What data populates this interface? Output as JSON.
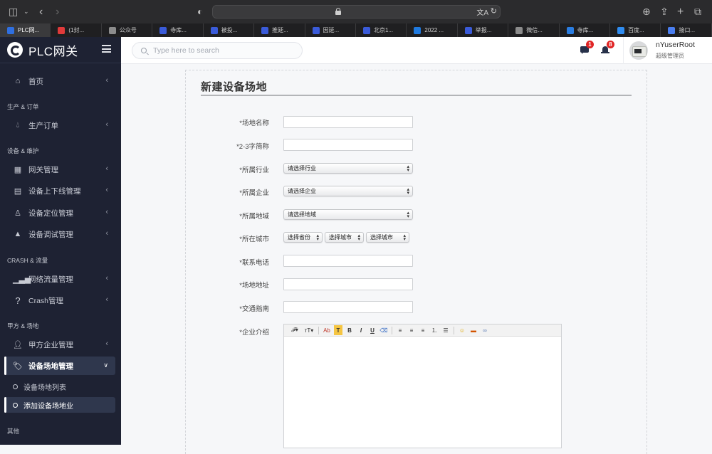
{
  "browser": {
    "tabs": [
      {
        "label": "PLC网...",
        "favicon_color": "#2f6fe0",
        "active": true
      },
      {
        "label": "(1封...",
        "favicon_color": "#e03a3a",
        "active": false
      },
      {
        "label": "公众号",
        "favicon_color": "#8c8c8c",
        "active": false
      },
      {
        "label": "寺库...",
        "favicon_color": "#3a5bd9",
        "active": false
      },
      {
        "label": "被投...",
        "favicon_color": "#3a5bd9",
        "active": false
      },
      {
        "label": "推延...",
        "favicon_color": "#3a5bd9",
        "active": false
      },
      {
        "label": "因延...",
        "favicon_color": "#3a5bd9",
        "active": false
      },
      {
        "label": "北京1...",
        "favicon_color": "#3a5bd9",
        "active": false
      },
      {
        "label": "2022 ...",
        "favicon_color": "#1f7ae0",
        "active": false
      },
      {
        "label": "举报...",
        "favicon_color": "#3a5bd9",
        "active": false
      },
      {
        "label": "微信...",
        "favicon_color": "#8c8c8c",
        "active": false
      },
      {
        "label": "寺库...",
        "favicon_color": "#2a7de1",
        "active": false
      },
      {
        "label": "百度...",
        "favicon_color": "#2f8cf0",
        "active": false
      },
      {
        "label": "接口...",
        "favicon_color": "#4a7ef0",
        "active": false
      }
    ]
  },
  "sidebar": {
    "brand": "PLC网关",
    "sections": [
      {
        "title": ""
      },
      {
        "title": "生产 & 订单"
      },
      {
        "title": "设备 & 维护"
      },
      {
        "title": "CRASH & 流量"
      },
      {
        "title": "甲方 & 场地"
      },
      {
        "title": "其他"
      }
    ],
    "items": [
      {
        "label": "首页",
        "icon": "home-icon"
      },
      {
        "label": "生产订单",
        "icon": "drop-icon"
      },
      {
        "label": "网关管理",
        "icon": "grid-icon"
      },
      {
        "label": "设备上下线管理",
        "icon": "document-icon"
      },
      {
        "label": "设备定位管理",
        "icon": "map-pin-user-icon"
      },
      {
        "label": "设备调试管理",
        "icon": "warning-icon"
      },
      {
        "label": "网络流量管理",
        "icon": "bar-chart-icon"
      },
      {
        "label": "Crash管理",
        "icon": "question-icon"
      },
      {
        "label": "甲方企业管理",
        "icon": "users-icon"
      },
      {
        "label": "设备场地管理",
        "icon": "tag-icon"
      }
    ],
    "subitems": [
      {
        "label": "设备场地列表"
      },
      {
        "label": "添加设备场地业"
      }
    ]
  },
  "header": {
    "search_placeholder": "Type here to search",
    "messages_count": "1",
    "notifications_count": "8",
    "user_name": "nYuserRoot",
    "user_role": "超级管理员"
  },
  "form": {
    "title": "新建设备场地",
    "fields": {
      "site_name": {
        "label": "*场地名称",
        "value": ""
      },
      "short_name": {
        "label": "*2-3字简称",
        "value": ""
      },
      "industry": {
        "label": "*所属行业",
        "selected": "请选择行业"
      },
      "company": {
        "label": "*所属企业",
        "selected": "请选择企业"
      },
      "region": {
        "label": "*所属地域",
        "selected": "请选择地域"
      },
      "city": {
        "label": "*所在城市",
        "province_selected": "选择省份",
        "city_selected": "选择城市",
        "district_selected": "选择城市"
      },
      "phone": {
        "label": "*联系电话",
        "value": ""
      },
      "address": {
        "label": "*场地地址",
        "value": ""
      },
      "traffic": {
        "label": "*交通指南",
        "value": ""
      },
      "intro": {
        "label": "*企业介绍",
        "value": ""
      }
    },
    "editor_toolbar": {
      "font_family": "𝓕▾",
      "font_size": "тT▾",
      "font_color": "Ab",
      "highlight": "T",
      "bold": "B",
      "italic": "I",
      "underline": "U",
      "eraser": "⌫"
    }
  }
}
